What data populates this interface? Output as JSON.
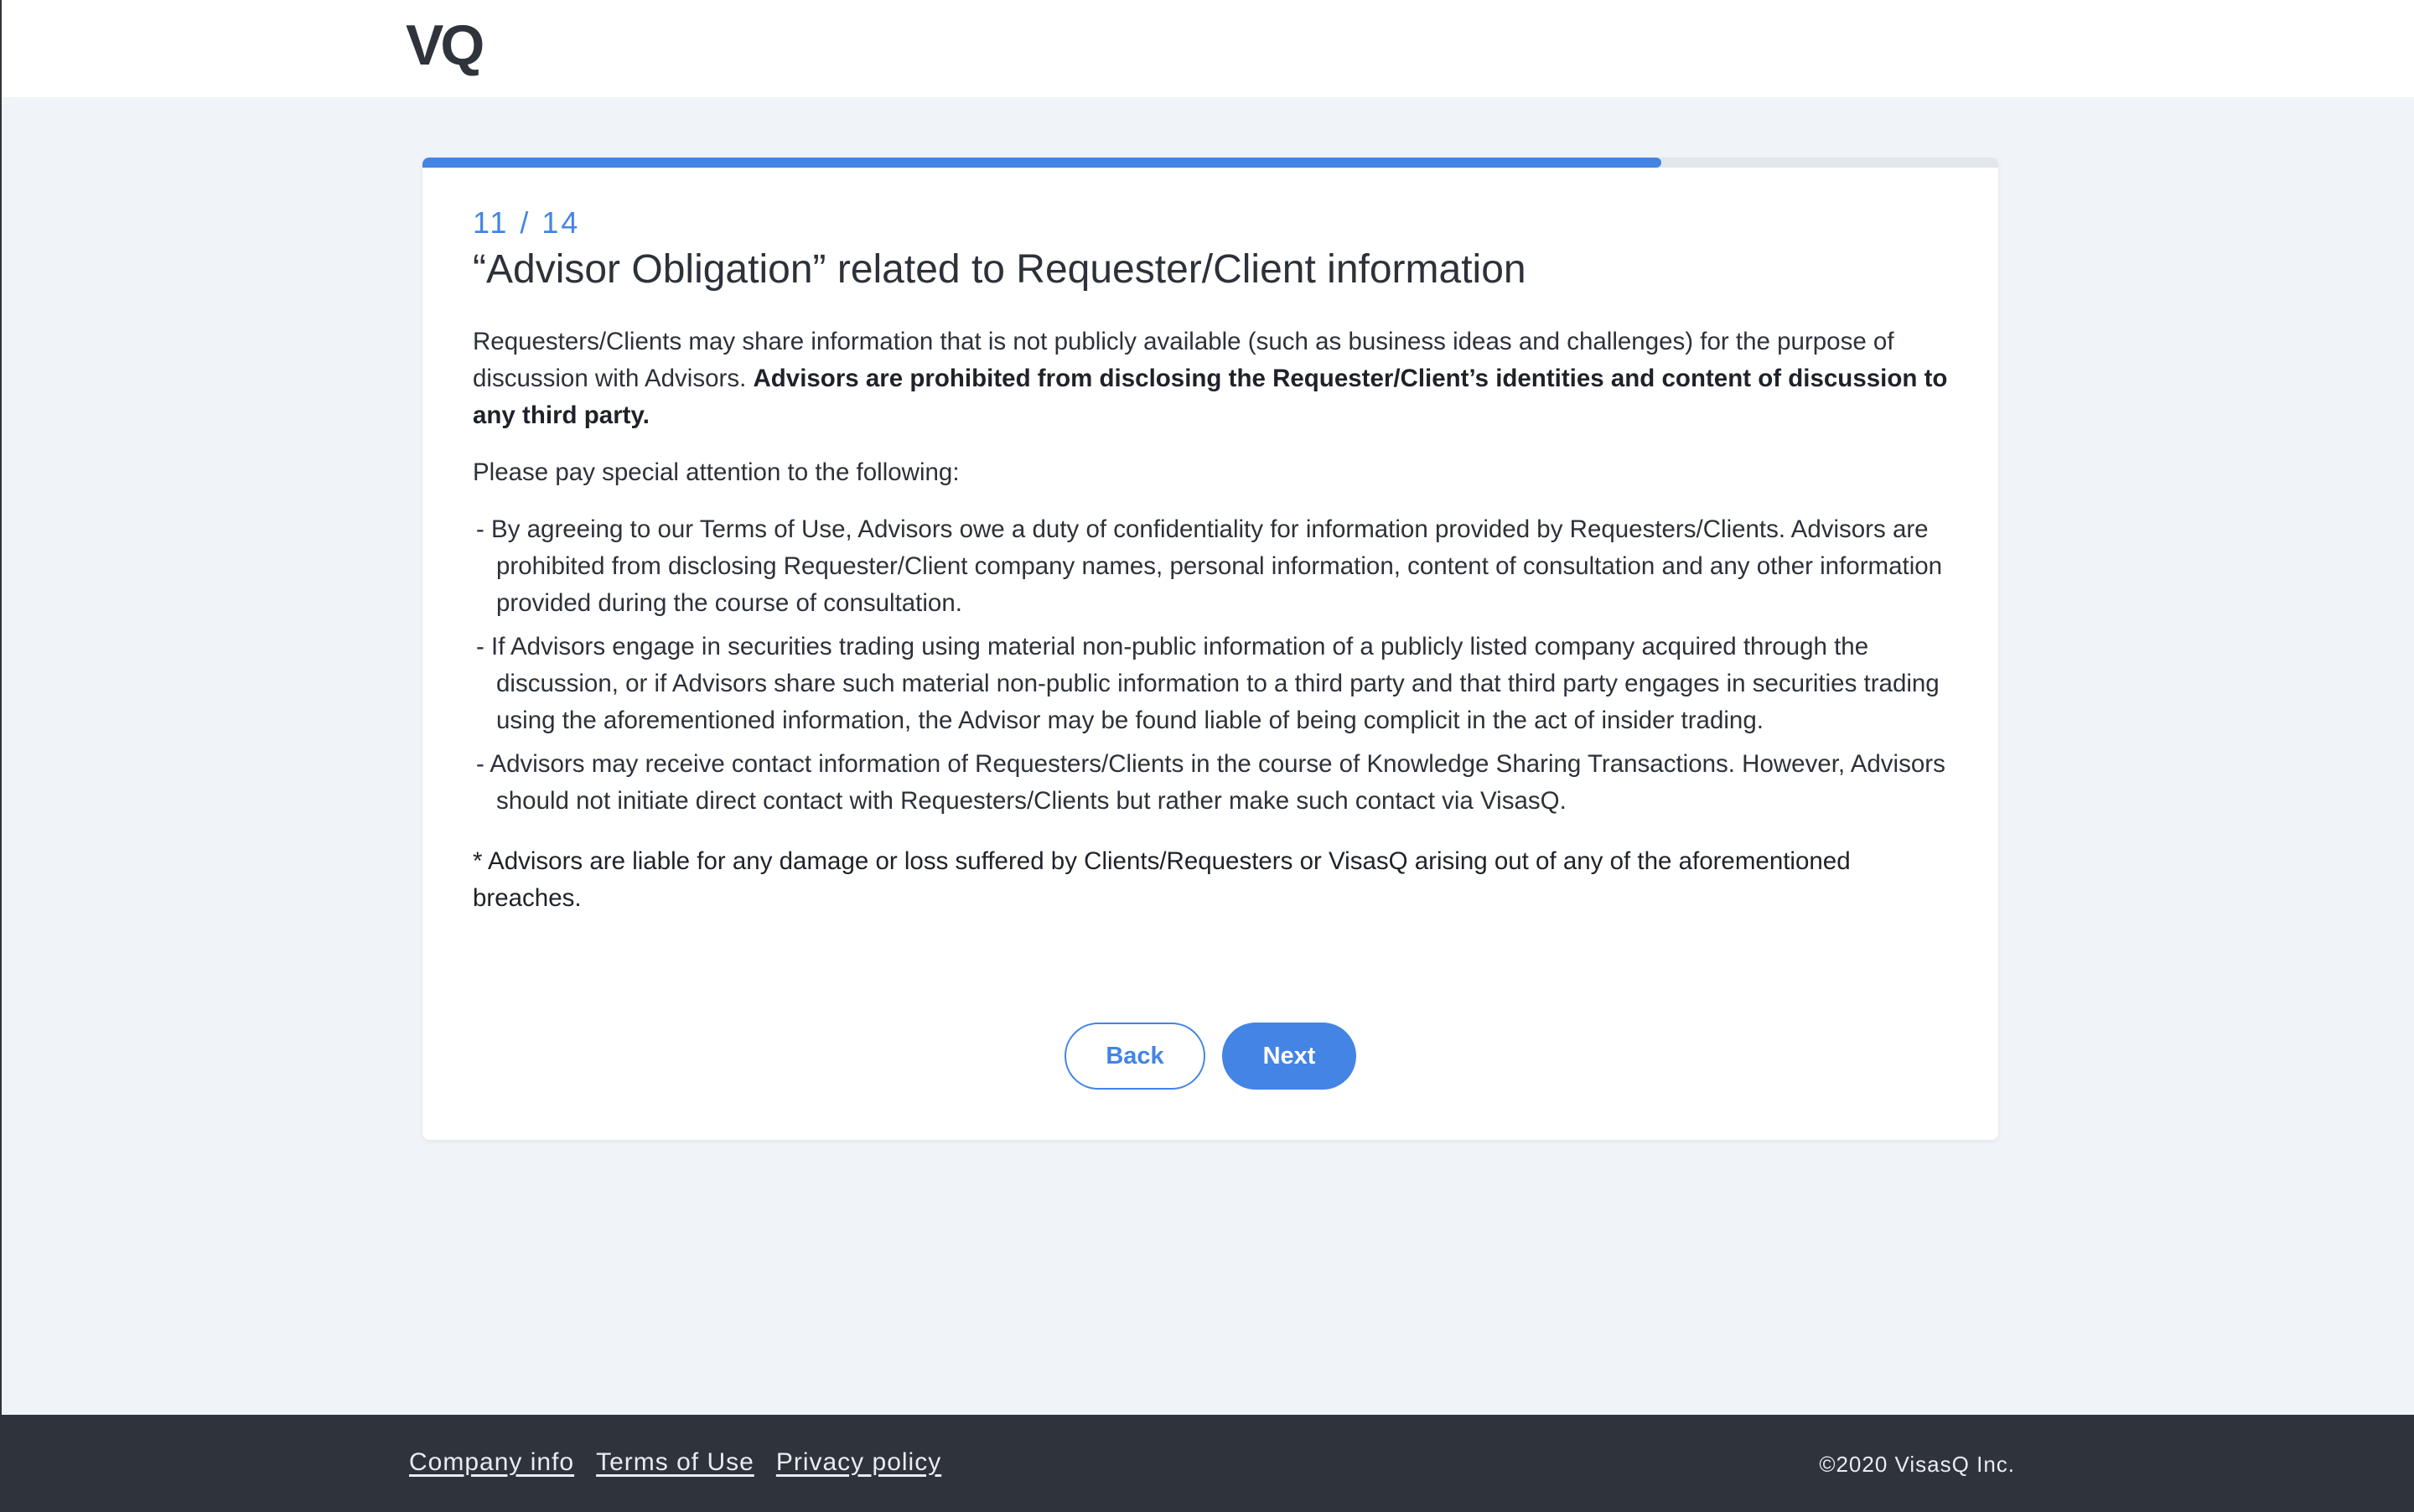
{
  "header": {
    "logo_text": "VQ"
  },
  "progress": {
    "current": 11,
    "total": 14,
    "fraction": 0.786,
    "step_label": "11 / 14",
    "color": "#4384e4"
  },
  "card": {
    "title": "“Advisor Obligation” related to Requester/Client information",
    "intro_plain": "Requesters/Clients may share information that is not publicly available (such as business ideas and challenges) for the purpose of discussion with Advisors. ",
    "intro_bold": "Advisors are prohibited from disclosing the Requester/Client’s identities and content of discussion to any third party.",
    "attention": "Please pay special attention to the following:",
    "items": [
      "- By agreeing to our Terms of Use, Advisors owe a duty of confidentiality for information provided by Requesters/Clients. Advisors are prohibited from disclosing Requester/Client company names, personal information, content of consultation and any other information provided during the course of consultation.",
      "- If Advisors engage in securities trading using material non-public information of a publicly listed company acquired through the discussion, or if Advisors share such material non-public information to a third party and that third party engages in securities trading using the aforementioned information, the Advisor may be found liable of being complicit in the act of insider trading.",
      "- Advisors may receive contact information of Requesters/Clients in the course of Knowledge Sharing Transactions. However, Advisors should not initiate direct contact with Requesters/Clients but rather make such contact via VisasQ."
    ],
    "note": "* Advisors are liable for any damage or loss suffered by Clients/Requesters or VisasQ arising out of any of the aforementioned breaches.",
    "back_label": "Back",
    "next_label": "Next"
  },
  "footer": {
    "links": [
      "Company info",
      "Terms of Use",
      "Privacy policy"
    ],
    "copyright": "©2020 VisasQ Inc."
  }
}
